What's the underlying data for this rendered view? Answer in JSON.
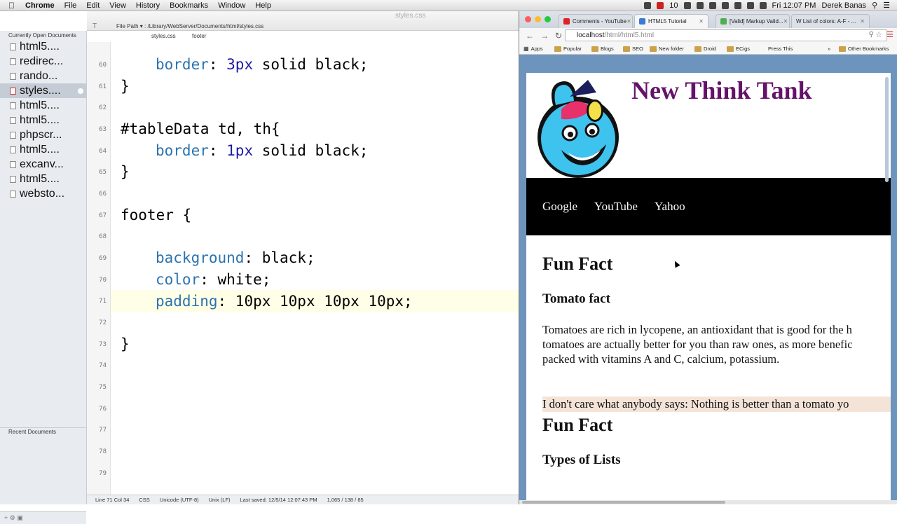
{
  "menubar": {
    "app": "Chrome",
    "items": [
      "File",
      "Edit",
      "View",
      "History",
      "Bookmarks",
      "Window",
      "Help"
    ],
    "status_number": "10",
    "clock": "Fri 12:07 PM",
    "user": "Derek Banas"
  },
  "editor": {
    "window_title": "styles.css",
    "sidebar_header": "Currently Open Documents",
    "documents": [
      "html5....",
      "redirec...",
      "rando...",
      "styles....",
      "html5....",
      "html5....",
      "phpscr...",
      "html5....",
      "excanv...",
      "html5....",
      "websto..."
    ],
    "selected_document": "styles....",
    "recent_header": "Recent Documents",
    "file_path_label": "File Path ▾ : /Library/WebServer/Documents/html/styles.css",
    "path_bar": [
      "styles.css",
      "footer"
    ],
    "line_numbers": [
      "60",
      "61",
      "62",
      "63",
      "64",
      "65",
      "66",
      "67",
      "68",
      "69",
      "70",
      "71",
      "72",
      "73",
      "74",
      "75",
      "76",
      "77",
      "78",
      "79"
    ],
    "code_lines": [
      {
        "n": "60",
        "prop": "border",
        "val": "3px",
        "rest": " solid black;"
      },
      {
        "n": "61",
        "text": "}"
      },
      {
        "n": "63",
        "text": "#tableData td, th{"
      },
      {
        "n": "64",
        "prop": "border",
        "val": "1px",
        "rest": " solid black;"
      },
      {
        "n": "65",
        "text": "}"
      },
      {
        "n": "67",
        "text": "footer {"
      },
      {
        "n": "69",
        "prop": "background",
        "rest": ": black;"
      },
      {
        "n": "70",
        "prop": "color",
        "rest": ": white;"
      },
      {
        "n": "71",
        "prop": "padding",
        "rest": ": 10px 10px 10px 10px;"
      },
      {
        "n": "73",
        "text": "}"
      }
    ],
    "status": {
      "position": "Line 71 Col 34",
      "language": "CSS",
      "encoding": "Unicode (UTF-8)",
      "line_endings": "Unix (LF)",
      "saved": "Last saved: 12/5/14 12:07:43 PM",
      "counts": "1,065 / 138 / 85"
    }
  },
  "browser": {
    "tabs": [
      {
        "label": "Comments - YouTube",
        "color": "#d22"
      },
      {
        "label": "HTML5 Tutorial",
        "color": "#3a79d4"
      },
      {
        "label": "[Valid] Markup Valid...",
        "color": "#4caf50"
      },
      {
        "label": "W List of colors: A-F - ...",
        "color": "#888"
      }
    ],
    "url_host": "localhost",
    "url_path": "/html/html5.html",
    "bookmarks": [
      "Apps",
      "Popular",
      "Blogs",
      "SEO",
      "New folder",
      "Droid",
      "ECigs",
      "Press This"
    ],
    "other_bookmarks": "Other Bookmarks",
    "overflow": "»"
  },
  "page": {
    "site_title": "New Think Tank",
    "nav_links": [
      "Google",
      "YouTube",
      "Yahoo"
    ],
    "fun_fact_1": "Fun Fact",
    "tomato_heading": "Tomato fact",
    "tomato_para": [
      "Tomatoes are rich in lycopene, an antioxidant that is good for the h",
      "tomatoes are actually better for you than raw ones, as more benefic",
      "packed with vitamins A and C, calcium, potassium."
    ],
    "quote": "I don't care what anybody says: Nothing is better than a tomato yo",
    "fun_fact_2": "Fun Fact",
    "lists_heading": "Types of Lists"
  }
}
